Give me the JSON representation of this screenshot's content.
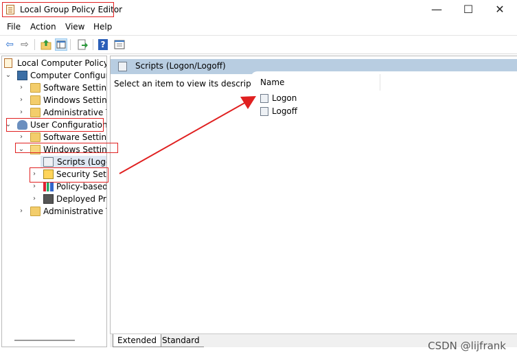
{
  "window": {
    "title": "Local Group Policy Editor",
    "minimize_glyph": "—",
    "maximize_glyph": "☐",
    "close_glyph": "✕"
  },
  "menu": {
    "items": [
      {
        "label": "File"
      },
      {
        "label": "Action"
      },
      {
        "label": "View"
      },
      {
        "label": "Help"
      }
    ]
  },
  "toolbar": {
    "buttons": [
      {
        "icon": "back-arrow-icon",
        "glyph": "⇦"
      },
      {
        "icon": "forward-arrow-icon",
        "glyph": "⇨"
      },
      {
        "icon": "up-folder-icon",
        "glyph": ""
      },
      {
        "icon": "show-hide-tree-icon",
        "glyph": ""
      },
      {
        "icon": "export-list-icon",
        "glyph": ""
      },
      {
        "icon": "help-icon",
        "glyph": "?"
      },
      {
        "icon": "properties-icon",
        "glyph": ""
      }
    ]
  },
  "tree": {
    "items": [
      {
        "label": "Local Computer Policy",
        "icon": "policy-document-icon",
        "expanded": "none"
      },
      {
        "label": "Computer Configura",
        "icon": "computer-icon",
        "expanded": "expanded"
      },
      {
        "label": "Software Settings",
        "icon": "folder-icon",
        "expanded": "collapsed"
      },
      {
        "label": "Windows Setting",
        "icon": "folder-icon",
        "expanded": "collapsed"
      },
      {
        "label": "Administrative Te",
        "icon": "folder-icon",
        "expanded": "collapsed"
      },
      {
        "label": "User Configuration",
        "icon": "user-icon",
        "expanded": "expanded"
      },
      {
        "label": "Software Settings",
        "icon": "folder-icon",
        "expanded": "collapsed"
      },
      {
        "label": "Windows Setting",
        "icon": "folder-open-icon",
        "expanded": "expanded"
      },
      {
        "label": "Scripts (Logon",
        "icon": "script-icon",
        "expanded": "none",
        "selected": true
      },
      {
        "label": "Security Settin",
        "icon": "security-lock-icon",
        "expanded": "collapsed"
      },
      {
        "label": "Policy-based",
        "icon": "bar-chart-icon",
        "expanded": "collapsed"
      },
      {
        "label": "Deployed Prir",
        "icon": "printer-icon",
        "expanded": "collapsed"
      },
      {
        "label": "Administrative Te",
        "icon": "folder-icon",
        "expanded": "collapsed"
      }
    ]
  },
  "details": {
    "header_title": "Scripts (Logon/Logoff)",
    "description": "Select an item to view its description.",
    "column_name": "Name",
    "items": [
      {
        "label": "Logon",
        "icon": "script-icon"
      },
      {
        "label": "Logoff",
        "icon": "script-icon"
      }
    ]
  },
  "tabs": [
    {
      "label": "Extended",
      "active": true
    },
    {
      "label": "Standard",
      "active": false
    }
  ],
  "watermark": "CSDN @lijfrank",
  "colors": {
    "annotation_red": "#e02020",
    "header_blue": "#b8cde1"
  }
}
